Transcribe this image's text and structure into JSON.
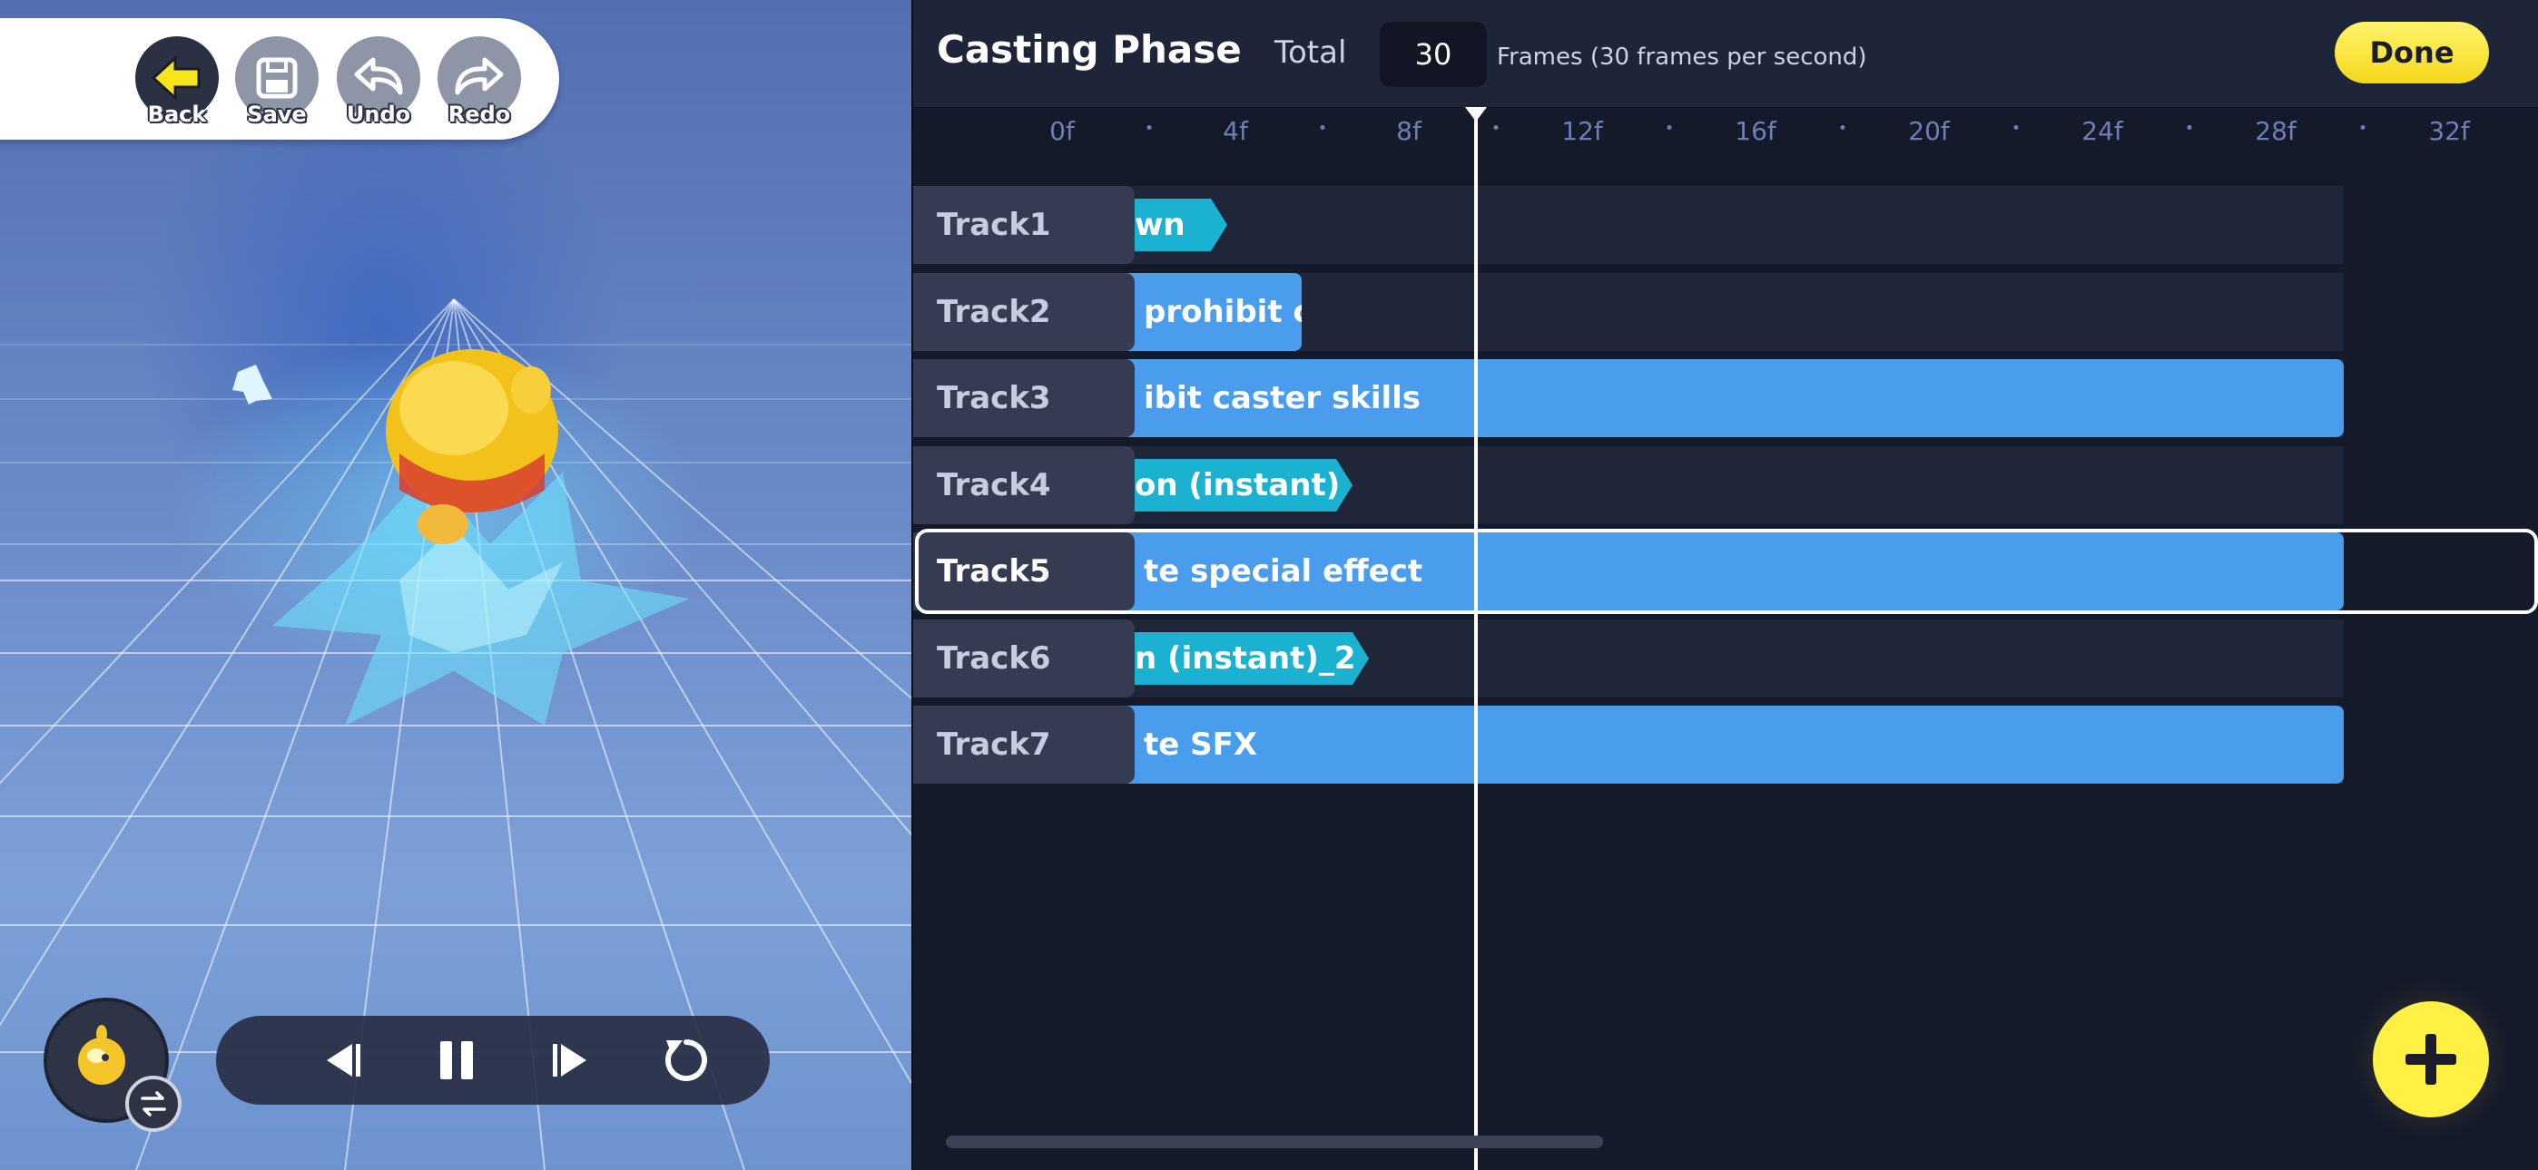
{
  "toolbar": {
    "back_label": "Back",
    "save_label": "Save",
    "undo_label": "Undo",
    "redo_label": "Redo"
  },
  "header": {
    "title": "Casting Phase",
    "total_label": "Total",
    "total_frames": "30",
    "frames_caption": "Frames (30 frames per second)",
    "done_label": "Done"
  },
  "ruler": {
    "labels": [
      "0f",
      "4f",
      "8f",
      "12f",
      "16f",
      "20f",
      "24f",
      "28f",
      "32f"
    ]
  },
  "tracks": [
    {
      "label": "Track1",
      "clip": "wn",
      "clip_kind": "instant"
    },
    {
      "label": "Track2",
      "clip": "prohibit cas",
      "clip_kind": "duration"
    },
    {
      "label": "Track3",
      "clip": "ibit caster skills",
      "clip_kind": "duration"
    },
    {
      "label": "Track4",
      "clip": "on (instant)",
      "clip_kind": "instant"
    },
    {
      "label": "Track5",
      "clip": "te special effect",
      "clip_kind": "duration",
      "selected": true
    },
    {
      "label": "Track6",
      "clip": "n (instant)_2",
      "clip_kind": "instant"
    },
    {
      "label": "Track7",
      "clip": "te SFX",
      "clip_kind": "duration"
    }
  ],
  "playhead_frame": 9.5,
  "playback": {
    "icons": [
      "step-back-icon",
      "pause-icon",
      "step-forward-icon",
      "restart-icon"
    ]
  },
  "colors": {
    "accent_yellow": "#fff043",
    "clip_blue": "#4a9cec",
    "clip_cyan": "#1bb2d2",
    "panel_bg": "#151a2b"
  }
}
